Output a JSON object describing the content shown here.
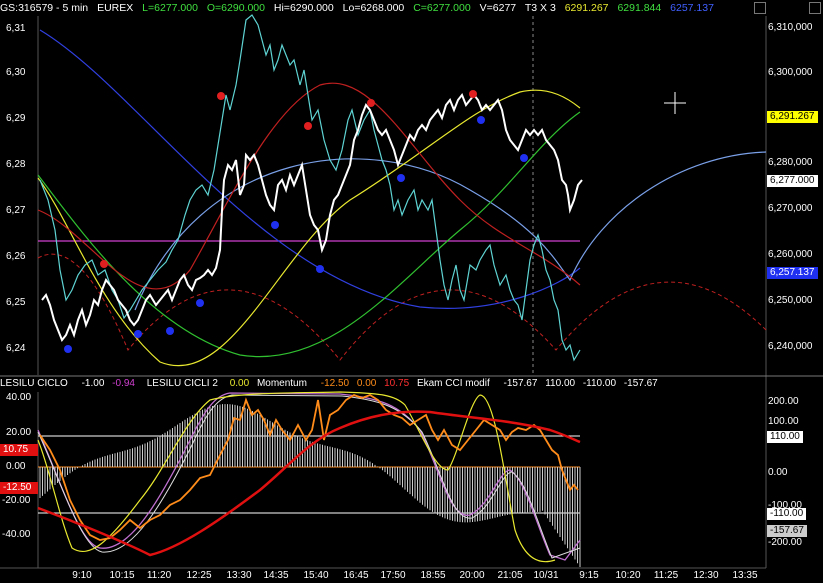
{
  "header": {
    "symbol": "GS:316579 - 5 min",
    "exchange": "EUREX",
    "last": "L=6277.000",
    "open": "O=6290.000",
    "high": "Hi=6290.000",
    "low": "Lo=6268.000",
    "close": "C=6277.000",
    "volume": "V=6277",
    "mode": "T3 X 3",
    "ind1": "6291.267",
    "ind2": "6291.844",
    "ind3": "6257.137"
  },
  "indicators_header": {
    "ciclo_name": "LESILU CICLO",
    "ciclo_v1": "-1.00",
    "ciclo_v2": "-0.94",
    "cicli2_name": "LESILU CICLI 2",
    "cicli2_v1": "0.00",
    "momentum_name": "Momentum",
    "momentum_v1": "-12.50",
    "momentum_v2": "0.00",
    "momentum_v3": "10.75",
    "cci_name": "Ekam CCI modif",
    "cci_v1": "-157.67",
    "cci_v2": "110.00",
    "cci_v3": "-110.00",
    "cci_v4": "-157.67"
  },
  "price_axis_left": [
    "6,31",
    "6,30",
    "6,29",
    "6,28",
    "6,27",
    "6,26",
    "6,25",
    "6,24"
  ],
  "price_axis_right": [
    "6,310,000",
    "6,300,000",
    "6,280,000",
    "6,270,000",
    "6,260,000",
    "6,250,000",
    "6,240,000"
  ],
  "price_badges": {
    "yellow": "6,291.267",
    "white": "6,277.000",
    "blue": "6,257.137"
  },
  "osc_axis_left": [
    "40.00",
    "20.00",
    "0.00",
    "-20.00",
    "-40.00"
  ],
  "osc_axis_right": [
    "200.00",
    "100.00",
    "0.00",
    "-100.00",
    "-200.00"
  ],
  "osc_badges_left": {
    "red": "10.75",
    "red2": "-12.50"
  },
  "osc_badges_right": {
    "b110": "110.00",
    "bm110": "-110.00",
    "bm157": "-157.67"
  },
  "time_axis": [
    "9:10",
    "10:15",
    "11:20",
    "12:25",
    "13:30",
    "14:35",
    "15:40",
    "16:45",
    "17:50",
    "18:55",
    "20:00",
    "21:05",
    "10/31",
    "9:15",
    "10:20",
    "11:25",
    "12:30",
    "13:35"
  ],
  "colors": {
    "background": "#000000",
    "price": "#ffffff",
    "cyan": "#5fd3d3",
    "magenta_level": "#d040d0",
    "yellow": "#e8e830",
    "green": "#30c030",
    "blue": "#3040e0",
    "red": "#c02020",
    "orange": "#ff8c1a"
  }
}
